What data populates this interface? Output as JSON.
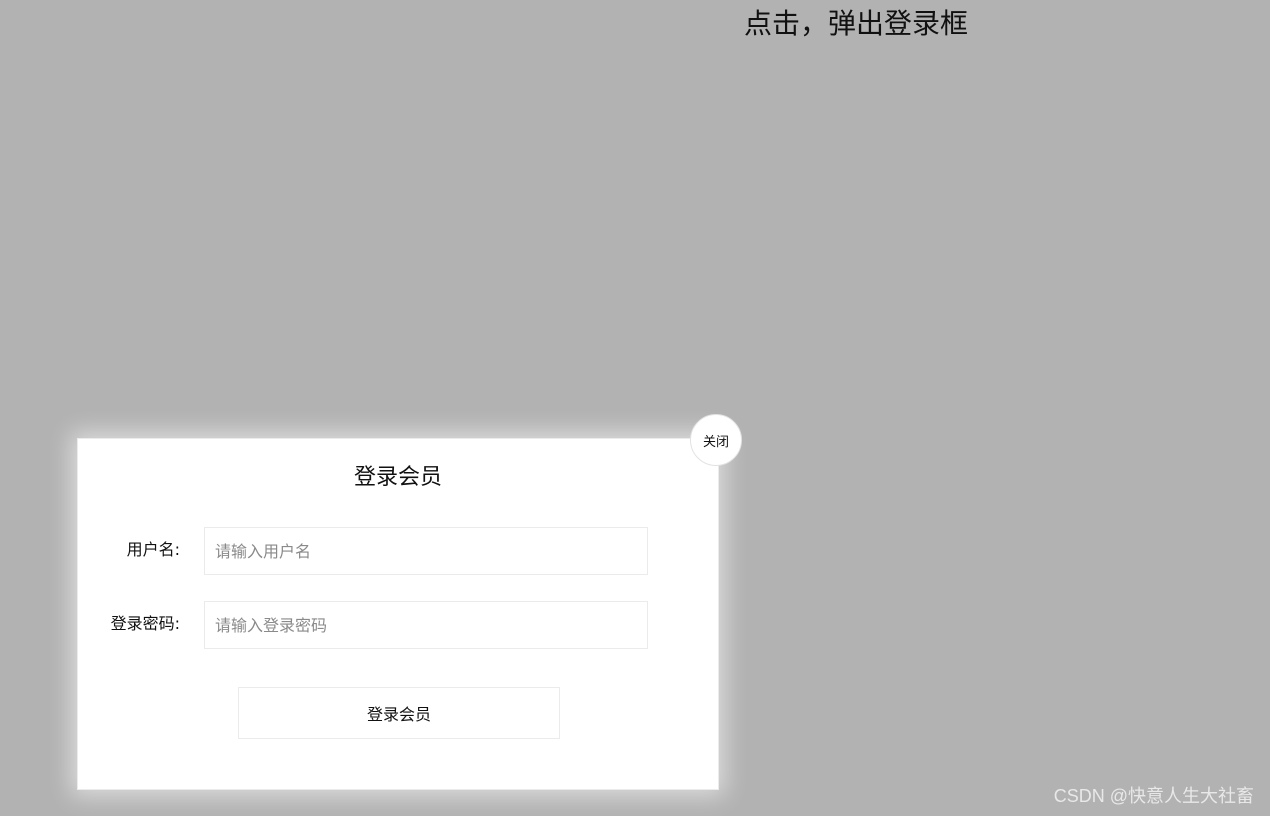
{
  "trigger": {
    "label": "点击，弹出登录框"
  },
  "modal": {
    "title": "登录会员",
    "close_label": "关闭",
    "fields": {
      "username": {
        "label": "用户名:",
        "placeholder": "请输入用户名",
        "value": ""
      },
      "password": {
        "label": "登录密码:",
        "placeholder": "请输入登录密码",
        "value": ""
      }
    },
    "submit_label": "登录会员"
  },
  "watermark": {
    "text": "CSDN @快意人生大社畜"
  },
  "colors": {
    "overlay_background": "#b2b2b2",
    "modal_background": "#ffffff",
    "border": "#ebebeb",
    "text": "#111111",
    "placeholder": "#8a8a8a"
  }
}
